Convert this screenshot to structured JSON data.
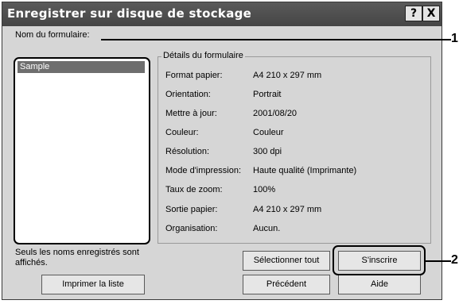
{
  "window": {
    "title": "Enregistrer sur disque de stockage",
    "help_button": "?",
    "close_button": "X"
  },
  "form_list": {
    "label": "Nom du formulaire:",
    "items": [
      {
        "label": "Sample",
        "selected": true
      }
    ]
  },
  "details": {
    "title": "Détails du formulaire",
    "rows": [
      {
        "label": "Format papier:",
        "value": "A4 210 x 297 mm"
      },
      {
        "label": "Orientation:",
        "value": "Portrait"
      },
      {
        "label": "Mettre à jour:",
        "value": "2001/08/20"
      },
      {
        "label": "Couleur:",
        "value": "Couleur"
      },
      {
        "label": "Résolution:",
        "value": "300 dpi"
      },
      {
        "label": "Mode d'impression:",
        "value": "Haute qualité (Imprimante)"
      },
      {
        "label": "Taux de zoom:",
        "value": "100%"
      },
      {
        "label": "Sortie papier:",
        "value": "A4 210 x 297 mm"
      },
      {
        "label": "Organisation:",
        "value": "Aucun."
      }
    ]
  },
  "note": {
    "line1": "Seuls les noms enregistrés sont",
    "line2": "affichés."
  },
  "buttons": {
    "print_list": "Imprimer la liste",
    "select_all": "Sélectionner tout",
    "register": "S'inscrire",
    "previous": "Précédent",
    "help": "Aide"
  },
  "callouts": [
    "1",
    "2"
  ]
}
